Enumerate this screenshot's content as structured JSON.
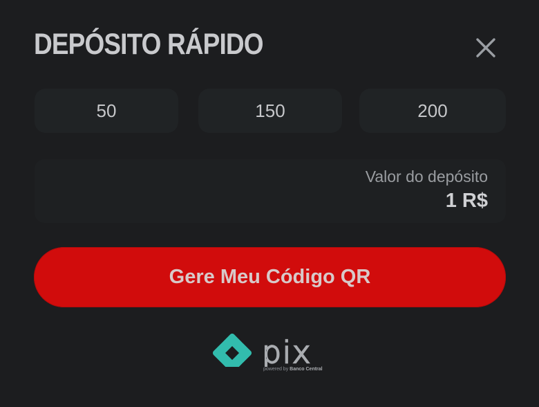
{
  "modal": {
    "title": "DEPÓSITO RÁPIDO",
    "close_icon": "close-icon"
  },
  "amounts": [
    {
      "label": "50"
    },
    {
      "label": "150"
    },
    {
      "label": "200"
    }
  ],
  "deposit": {
    "label": "Valor do depósito",
    "value": "1 R$"
  },
  "action": {
    "label": "Gere Meu Código QR"
  },
  "pix": {
    "wordmark": "pix",
    "caption_prefix": "powered by",
    "caption_brand": "Banco Central",
    "icon": "pix-logo-icon"
  },
  "colors": {
    "background": "#1c1d1f",
    "button_red": "#d10c0c",
    "pix_teal": "#32bcad"
  }
}
